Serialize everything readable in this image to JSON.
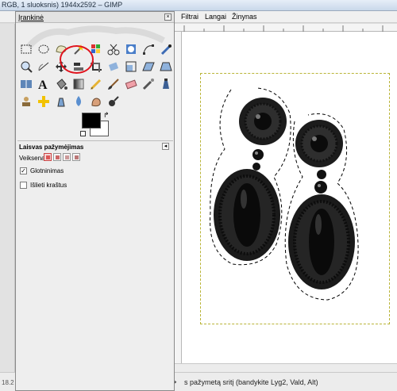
{
  "window": {
    "title": "RGB, 1 sluoksnis) 1944x2592 – GIMP"
  },
  "menubar": {
    "items": [
      "Filtrai",
      "Langai",
      "Žinynas"
    ]
  },
  "toolbox": {
    "title": "Įrankinė",
    "close_icon": "×",
    "tools": [
      {
        "name": "rect-select-icon"
      },
      {
        "name": "ellipse-select-icon"
      },
      {
        "name": "free-select-icon"
      },
      {
        "name": "fuzzy-select-icon"
      },
      {
        "name": "color-select-icon"
      },
      {
        "name": "scissors-icon"
      },
      {
        "name": "foreground-select-icon"
      },
      {
        "name": "paths-icon"
      },
      {
        "name": "color-picker-icon"
      },
      {
        "name": "zoom-icon"
      },
      {
        "name": "measure-icon"
      },
      {
        "name": "move-icon"
      },
      {
        "name": "align-icon"
      },
      {
        "name": "crop-icon"
      },
      {
        "name": "rotate-icon"
      },
      {
        "name": "scale-icon"
      },
      {
        "name": "shear-icon"
      },
      {
        "name": "perspective-icon"
      },
      {
        "name": "flip-icon"
      },
      {
        "name": "text-icon"
      },
      {
        "name": "bucket-fill-icon"
      },
      {
        "name": "blend-icon"
      },
      {
        "name": "pencil-icon"
      },
      {
        "name": "paintbrush-icon"
      },
      {
        "name": "eraser-icon"
      },
      {
        "name": "airbrush-icon"
      },
      {
        "name": "ink-icon"
      },
      {
        "name": "clone-icon"
      },
      {
        "name": "heal-icon"
      },
      {
        "name": "perspective-clone-icon"
      },
      {
        "name": "blur-icon"
      },
      {
        "name": "smudge-icon"
      },
      {
        "name": "dodge-burn-icon"
      }
    ],
    "colors": {
      "foreground": "#000000",
      "background": "#ffffff"
    },
    "options": {
      "title": "Laisvas pažymėjimas",
      "mode_label": "Veiksena:",
      "smoothing_label": "Glotninimas",
      "smoothing_checked": true,
      "feather_label": "Išlieti kraštus",
      "feather_checked": false
    }
  },
  "status": {
    "zoom": "18.2",
    "text": "s pažymetą sritį (bandykite Lyg2, Vald, Alt)"
  },
  "accent": "#e0141e"
}
